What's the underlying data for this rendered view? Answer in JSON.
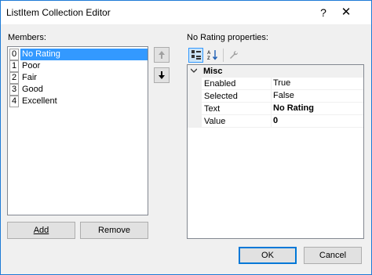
{
  "window": {
    "title": "ListItem Collection Editor",
    "help_glyph": "?",
    "close_glyph": "✕"
  },
  "members": {
    "label": "Members:",
    "items": [
      {
        "index": "0",
        "name": "No Rating",
        "selected": true
      },
      {
        "index": "1",
        "name": "Poor",
        "selected": false
      },
      {
        "index": "2",
        "name": "Fair",
        "selected": false
      },
      {
        "index": "3",
        "name": "Good",
        "selected": false
      },
      {
        "index": "4",
        "name": "Excellent",
        "selected": false
      }
    ],
    "move_up_glyph": "🡑",
    "move_down_glyph": "🡓",
    "add_label": "Add",
    "remove_label": "Remove"
  },
  "properties": {
    "label": "No Rating properties:",
    "toolbar": {
      "categorized_icon": "categorized-icon",
      "alphabetical_icon": "alphabetical-icon",
      "property_pages_icon": "wrench-icon"
    },
    "category": {
      "name": "Misc",
      "toggle_glyph": "v"
    },
    "rows": [
      {
        "name": "Enabled",
        "value": "True",
        "bold": false
      },
      {
        "name": "Selected",
        "value": "False",
        "bold": false
      },
      {
        "name": "Text",
        "value": "No Rating",
        "bold": true
      },
      {
        "name": "Value",
        "value": "0",
        "bold": true
      }
    ]
  },
  "footer": {
    "ok_label": "OK",
    "cancel_label": "Cancel"
  },
  "colors": {
    "selection": "#3399ff",
    "window_border": "#1e7bd6",
    "default_button_border": "#0078d7"
  }
}
